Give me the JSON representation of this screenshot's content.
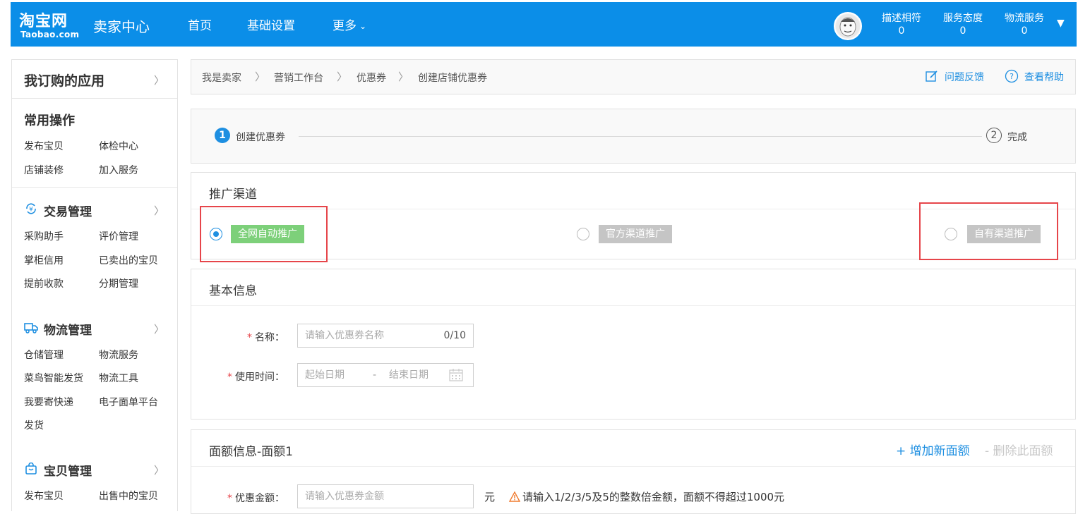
{
  "header": {
    "logo_main": "淘宝网",
    "logo_sub": "Taobao.com",
    "app_name": "卖家中心",
    "nav": [
      "首页",
      "基础设置",
      "更多"
    ],
    "stats": [
      {
        "label": "描述相符",
        "value": "0"
      },
      {
        "label": "服务态度",
        "value": "0"
      },
      {
        "label": "物流服务",
        "value": "0"
      }
    ],
    "brand_color": "#0b8ee8"
  },
  "sidebar": {
    "header": "我订购的应用",
    "common": {
      "title": "常用操作",
      "links": [
        "发布宝贝",
        "体检中心",
        "店铺装修",
        "加入服务"
      ]
    },
    "trade": {
      "title": "交易管理",
      "links": [
        "采购助手",
        "评价管理",
        "掌柜信用",
        "已卖出的宝贝",
        "提前收款",
        "分期管理"
      ]
    },
    "logistics": {
      "title": "物流管理",
      "links": [
        "仓储管理",
        "物流服务",
        "菜鸟智能发货",
        "物流工具",
        "我要寄快递",
        "电子面单平台",
        "发货"
      ]
    },
    "goods": {
      "title": "宝贝管理",
      "links": [
        "发布宝贝",
        "出售中的宝贝"
      ]
    }
  },
  "breadcrumb": {
    "items": [
      "我是卖家",
      "营销工作台",
      "优惠券",
      "创建店铺优惠券"
    ],
    "feedback": "问题反馈",
    "help": "查看帮助"
  },
  "steps": [
    {
      "num": "1",
      "label": "创建优惠券",
      "active": true
    },
    {
      "num": "2",
      "label": "完成",
      "active": false
    }
  ],
  "promo": {
    "title": "推广渠道",
    "options": [
      {
        "label": "全网自动推广",
        "selected": true
      },
      {
        "label": "官方渠道推广",
        "selected": false
      },
      {
        "label": "自有渠道推广",
        "selected": false
      }
    ]
  },
  "basic": {
    "title": "基本信息",
    "name_label": "名称：",
    "name_placeholder": "请输入优惠券名称",
    "name_counter": "0/10",
    "time_label": "使用时间：",
    "start_placeholder": "起始日期",
    "date_separator": "-",
    "end_placeholder": "结束日期"
  },
  "amount": {
    "title": "面额信息-面额1",
    "add": "+ 增加新面额",
    "remove": "- 删除此面额",
    "amount_label": "优惠金额：",
    "amount_placeholder": "请输入优惠券金额",
    "unit": "元",
    "warning": "请输入1/2/3/5及5的整数倍金额，面额不得超过1000元"
  }
}
